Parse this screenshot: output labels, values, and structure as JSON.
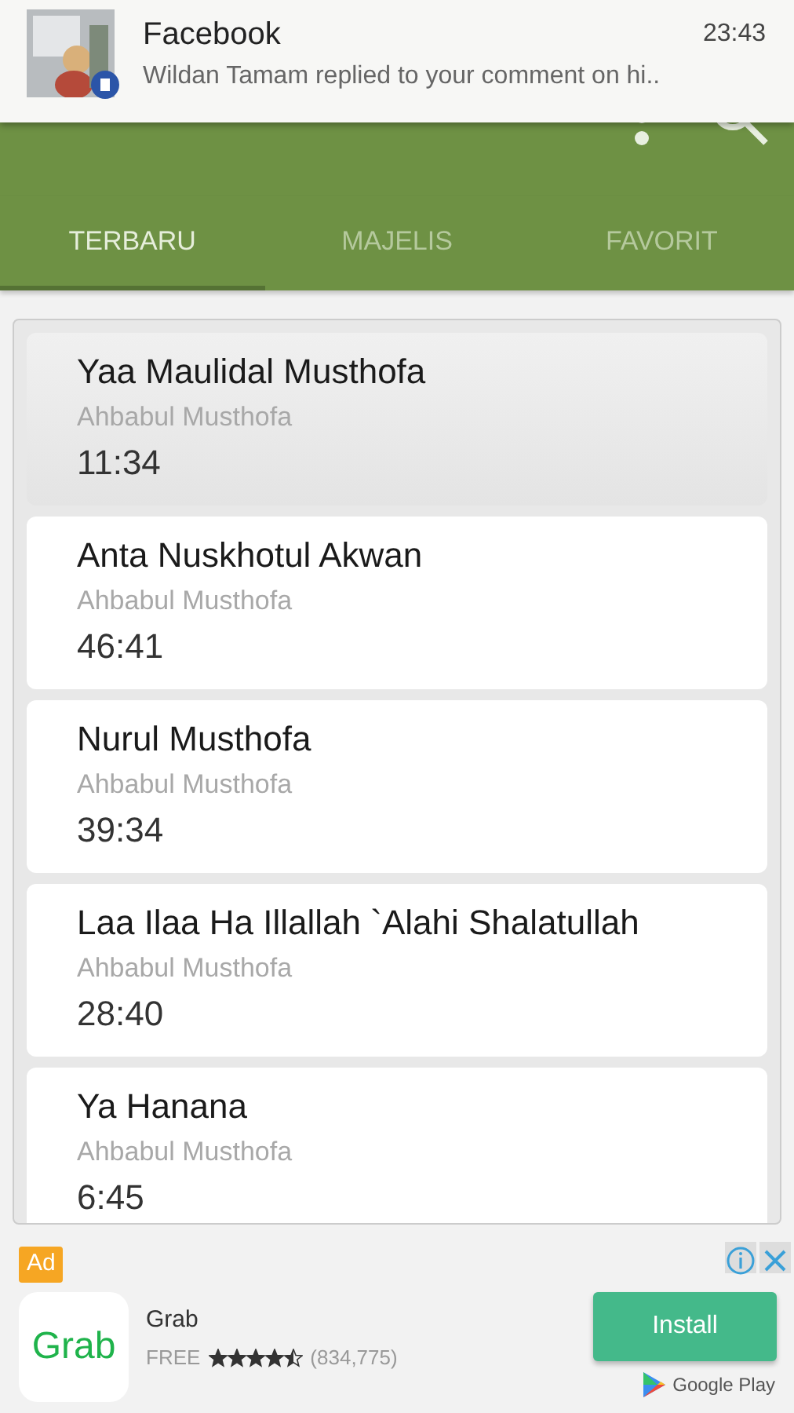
{
  "notification": {
    "app": "Facebook",
    "time": "23:43",
    "message": "Wildan Tamam replied to your comment on hi.."
  },
  "tabs": [
    {
      "label": "TERBARU",
      "selected": true
    },
    {
      "label": "MAJELIS",
      "selected": false
    },
    {
      "label": "FAVORIT",
      "selected": false
    }
  ],
  "tracks": [
    {
      "title": "Yaa Maulidal Musthofa",
      "artist": "Ahbabul Musthofa",
      "duration": "11:34",
      "selected": true
    },
    {
      "title": "Anta Nuskhotul Akwan",
      "artist": "Ahbabul Musthofa",
      "duration": "46:41",
      "selected": false
    },
    {
      "title": "Nurul Musthofa",
      "artist": "Ahbabul Musthofa",
      "duration": "39:34",
      "selected": false
    },
    {
      "title": "Laa Ilaa Ha Illallah `Alahi Shalatullah",
      "artist": "Ahbabul Musthofa",
      "duration": "28:40",
      "selected": false
    },
    {
      "title": "Ya Hanana",
      "artist": "Ahbabul Musthofa",
      "duration": "6:45",
      "selected": false
    }
  ],
  "ad": {
    "badge": "Ad",
    "logo": "Grab",
    "name": "Grab",
    "price": "FREE",
    "stars": 4.5,
    "reviews": "(834,775)",
    "button": "Install",
    "store": "Google Play"
  }
}
